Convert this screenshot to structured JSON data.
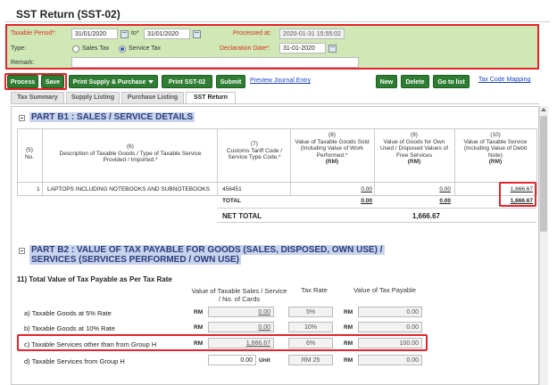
{
  "page": {
    "title": "SST Return (SST-02)"
  },
  "filters": {
    "taxable_period_label": "Taxable Period*:",
    "period_from": "31/01/2020",
    "to_label": "to*",
    "period_to": "31/01/2020",
    "processed_at_label": "Processed at:",
    "processed_at_value": "2020-01-31 15:55:02",
    "type_label": "Type:",
    "type_sales": "Sales Tax",
    "type_service": "Service Tax",
    "declaration_label": "Declaration Date*:",
    "declaration_value": "31-01-2020",
    "remark_label": "Remark:",
    "remark_value": ""
  },
  "toolbar": {
    "process": "Process",
    "save": "Save",
    "print_supply": "Print Supply & Purchase",
    "print_sst": "Print SST-02",
    "submit": "Submit",
    "preview": "Preview Journal Entry",
    "new": "New",
    "delete": "Delete",
    "go_to_list": "Go to list",
    "tax_code_mapping": "Tax Code Mapping"
  },
  "tabs": [
    "Tax Summary",
    "Supply Listing",
    "Purchase Listing",
    "SST Return"
  ],
  "part_b1": {
    "heading": "PART B1 : SALES / SERVICE DETAILS",
    "columns": [
      {
        "num": "(5)",
        "text": "No."
      },
      {
        "num": "(6)",
        "text": "Description of Taxable Goods / Type of Taxable Service Provided / Imported.*"
      },
      {
        "num": "(7)",
        "text": "Customs Tariff Code / Service Type Code.*"
      },
      {
        "num": "(8)",
        "text": "Value of Taxable Goods Sold (Including Value of Work Performed.*",
        "unit": "(RM)"
      },
      {
        "num": "(9)",
        "text": "Value of Goods for Own Used / Disposed Values of Free Services",
        "unit": "(RM)"
      },
      {
        "num": "(10)",
        "text": "Value of Taxable Service (Including Value of Debit Note)",
        "unit": "(RM)"
      }
    ],
    "rows": [
      {
        "no": "1",
        "desc": "LAPTOPS INCLUDING NOTEBOOKS AND SUBNOTEBOOKS",
        "code": "456451",
        "goods": "0.00",
        "own": "0.00",
        "service": "1,666.67"
      }
    ],
    "total_label": "TOTAL",
    "total_goods": "0.00",
    "total_own": "0.00",
    "total_service": "1,666.67",
    "net_total_label": "NET TOTAL",
    "net_total_value": "1,666.67"
  },
  "part_b2": {
    "heading_line1": "PART B2 : VALUE OF TAX PAYABLE FOR GOODS (SALES, DISPOSED, OWN USE) /",
    "heading_line2": "SERVICES (SERVICES PERFORMED / OWN USE)",
    "sub_heading": "11) Total Value of Tax Payable as Per Tax Rate",
    "col_value": "Value of Taxable Sales / Service / No. of Cards",
    "col_rate": "Tax Rate",
    "col_payable": "Value of Tax Payable",
    "currency": "RM",
    "unit_label": "Unit",
    "rows": [
      {
        "label": "a) Taxable Goods at 5% Rate",
        "value": "0.00",
        "rate": "5%",
        "payable": "0.00"
      },
      {
        "label": "b) Taxable Goods at 10% Rate",
        "value": "0.00",
        "rate": "10%",
        "payable": "0.00"
      },
      {
        "label": "c) Taxable Services other than from Group H",
        "value": "1,666.67",
        "rate": "6%",
        "payable": "100.00"
      },
      {
        "label": "d) Taxable Services from Group H",
        "value": "0.00",
        "rate": "RM 25",
        "payable": "0.00"
      }
    ]
  }
}
